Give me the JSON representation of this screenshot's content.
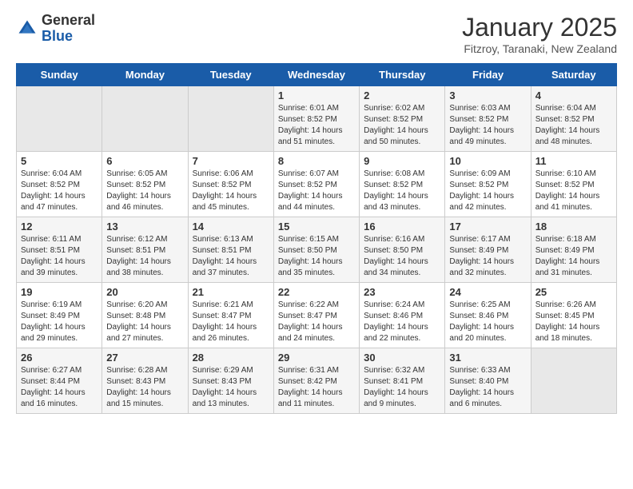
{
  "logo": {
    "general": "General",
    "blue": "Blue"
  },
  "header": {
    "month": "January 2025",
    "location": "Fitzroy, Taranaki, New Zealand"
  },
  "weekdays": [
    "Sunday",
    "Monday",
    "Tuesday",
    "Wednesday",
    "Thursday",
    "Friday",
    "Saturday"
  ],
  "weeks": [
    [
      {
        "day": "",
        "info": ""
      },
      {
        "day": "",
        "info": ""
      },
      {
        "day": "",
        "info": ""
      },
      {
        "day": "1",
        "info": "Sunrise: 6:01 AM\nSunset: 8:52 PM\nDaylight: 14 hours\nand 51 minutes."
      },
      {
        "day": "2",
        "info": "Sunrise: 6:02 AM\nSunset: 8:52 PM\nDaylight: 14 hours\nand 50 minutes."
      },
      {
        "day": "3",
        "info": "Sunrise: 6:03 AM\nSunset: 8:52 PM\nDaylight: 14 hours\nand 49 minutes."
      },
      {
        "day": "4",
        "info": "Sunrise: 6:04 AM\nSunset: 8:52 PM\nDaylight: 14 hours\nand 48 minutes."
      }
    ],
    [
      {
        "day": "5",
        "info": "Sunrise: 6:04 AM\nSunset: 8:52 PM\nDaylight: 14 hours\nand 47 minutes."
      },
      {
        "day": "6",
        "info": "Sunrise: 6:05 AM\nSunset: 8:52 PM\nDaylight: 14 hours\nand 46 minutes."
      },
      {
        "day": "7",
        "info": "Sunrise: 6:06 AM\nSunset: 8:52 PM\nDaylight: 14 hours\nand 45 minutes."
      },
      {
        "day": "8",
        "info": "Sunrise: 6:07 AM\nSunset: 8:52 PM\nDaylight: 14 hours\nand 44 minutes."
      },
      {
        "day": "9",
        "info": "Sunrise: 6:08 AM\nSunset: 8:52 PM\nDaylight: 14 hours\nand 43 minutes."
      },
      {
        "day": "10",
        "info": "Sunrise: 6:09 AM\nSunset: 8:52 PM\nDaylight: 14 hours\nand 42 minutes."
      },
      {
        "day": "11",
        "info": "Sunrise: 6:10 AM\nSunset: 8:52 PM\nDaylight: 14 hours\nand 41 minutes."
      }
    ],
    [
      {
        "day": "12",
        "info": "Sunrise: 6:11 AM\nSunset: 8:51 PM\nDaylight: 14 hours\nand 39 minutes."
      },
      {
        "day": "13",
        "info": "Sunrise: 6:12 AM\nSunset: 8:51 PM\nDaylight: 14 hours\nand 38 minutes."
      },
      {
        "day": "14",
        "info": "Sunrise: 6:13 AM\nSunset: 8:51 PM\nDaylight: 14 hours\nand 37 minutes."
      },
      {
        "day": "15",
        "info": "Sunrise: 6:15 AM\nSunset: 8:50 PM\nDaylight: 14 hours\nand 35 minutes."
      },
      {
        "day": "16",
        "info": "Sunrise: 6:16 AM\nSunset: 8:50 PM\nDaylight: 14 hours\nand 34 minutes."
      },
      {
        "day": "17",
        "info": "Sunrise: 6:17 AM\nSunset: 8:49 PM\nDaylight: 14 hours\nand 32 minutes."
      },
      {
        "day": "18",
        "info": "Sunrise: 6:18 AM\nSunset: 8:49 PM\nDaylight: 14 hours\nand 31 minutes."
      }
    ],
    [
      {
        "day": "19",
        "info": "Sunrise: 6:19 AM\nSunset: 8:49 PM\nDaylight: 14 hours\nand 29 minutes."
      },
      {
        "day": "20",
        "info": "Sunrise: 6:20 AM\nSunset: 8:48 PM\nDaylight: 14 hours\nand 27 minutes."
      },
      {
        "day": "21",
        "info": "Sunrise: 6:21 AM\nSunset: 8:47 PM\nDaylight: 14 hours\nand 26 minutes."
      },
      {
        "day": "22",
        "info": "Sunrise: 6:22 AM\nSunset: 8:47 PM\nDaylight: 14 hours\nand 24 minutes."
      },
      {
        "day": "23",
        "info": "Sunrise: 6:24 AM\nSunset: 8:46 PM\nDaylight: 14 hours\nand 22 minutes."
      },
      {
        "day": "24",
        "info": "Sunrise: 6:25 AM\nSunset: 8:46 PM\nDaylight: 14 hours\nand 20 minutes."
      },
      {
        "day": "25",
        "info": "Sunrise: 6:26 AM\nSunset: 8:45 PM\nDaylight: 14 hours\nand 18 minutes."
      }
    ],
    [
      {
        "day": "26",
        "info": "Sunrise: 6:27 AM\nSunset: 8:44 PM\nDaylight: 14 hours\nand 16 minutes."
      },
      {
        "day": "27",
        "info": "Sunrise: 6:28 AM\nSunset: 8:43 PM\nDaylight: 14 hours\nand 15 minutes."
      },
      {
        "day": "28",
        "info": "Sunrise: 6:29 AM\nSunset: 8:43 PM\nDaylight: 14 hours\nand 13 minutes."
      },
      {
        "day": "29",
        "info": "Sunrise: 6:31 AM\nSunset: 8:42 PM\nDaylight: 14 hours\nand 11 minutes."
      },
      {
        "day": "30",
        "info": "Sunrise: 6:32 AM\nSunset: 8:41 PM\nDaylight: 14 hours\nand 9 minutes."
      },
      {
        "day": "31",
        "info": "Sunrise: 6:33 AM\nSunset: 8:40 PM\nDaylight: 14 hours\nand 6 minutes."
      },
      {
        "day": "",
        "info": ""
      }
    ]
  ]
}
